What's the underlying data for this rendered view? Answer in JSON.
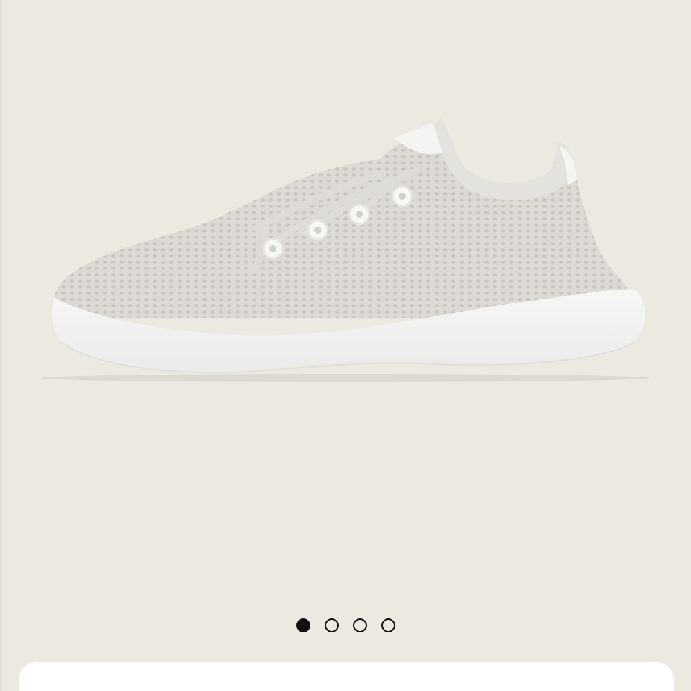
{
  "product": {
    "image_alt": "",
    "image_icon": "sneaker-product-image"
  },
  "carousel": {
    "slide_count": 4,
    "active_index": 0,
    "dots": [
      {
        "state": "active"
      },
      {
        "state": "inactive"
      },
      {
        "state": "inactive"
      },
      {
        "state": "inactive"
      }
    ]
  },
  "colors": {
    "background": "#ece9e1",
    "dot_active": "#111111",
    "sheet": "#ffffff",
    "shoe_knit": "#dcdad6",
    "shoe_sole": "#f3f3f3"
  }
}
